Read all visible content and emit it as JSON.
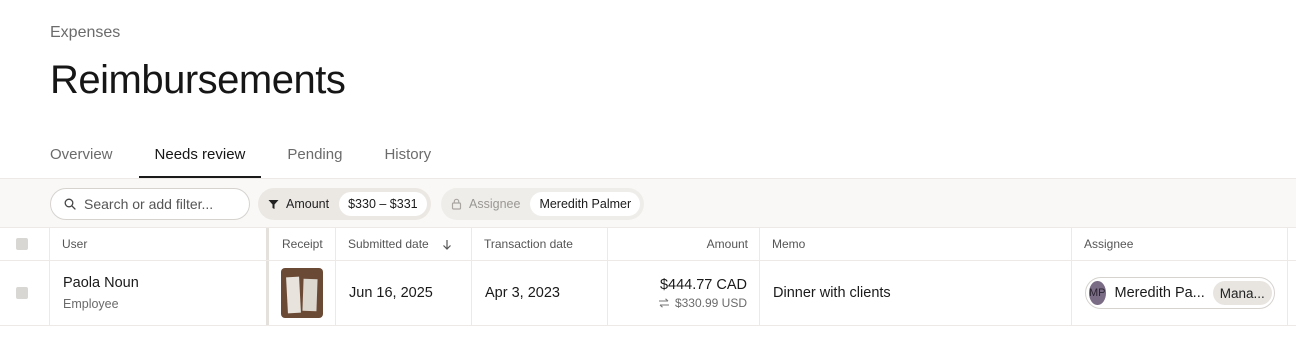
{
  "header": {
    "breadcrumb": "Expenses",
    "title": "Reimbursements"
  },
  "tabs": [
    {
      "label": "Overview",
      "active": false
    },
    {
      "label": "Needs review",
      "active": true
    },
    {
      "label": "Pending",
      "active": false
    },
    {
      "label": "History",
      "active": false
    }
  ],
  "filters": {
    "search_placeholder": "Search or add filter...",
    "amount": {
      "label": "Amount",
      "value": "$330 – $331"
    },
    "assignee": {
      "label": "Assignee",
      "value": "Meredith Palmer",
      "locked": true
    }
  },
  "table": {
    "columns": {
      "user": "User",
      "receipt": "Receipt",
      "submitted": "Submitted date",
      "transaction": "Transaction date",
      "amount": "Amount",
      "memo": "Memo",
      "assignee": "Assignee"
    },
    "sort": {
      "column": "Submitted date",
      "direction": "descending"
    },
    "rows": [
      {
        "user_name": "Paola Noun",
        "user_role": "Employee",
        "submitted_date": "Jun 16, 2025",
        "transaction_date": "Apr 3, 2023",
        "amount": "$444.77 CAD",
        "amount_converted": "$330.99 USD",
        "memo": "Dinner with clients",
        "assignee_initials": "MP",
        "assignee_name": "Meredith Pa...",
        "assignee_role": "Mana..."
      }
    ]
  },
  "colors": {
    "filterbar_bg": "#faf8f6",
    "chip_bg": "#ebe8e4",
    "avatar_bg": "#7b6c86",
    "active_tab_underline": "#1a1a1a"
  },
  "icons": [
    "search-icon",
    "filter-icon",
    "lock-icon",
    "sort-down-icon",
    "currency-exchange-icon"
  ]
}
